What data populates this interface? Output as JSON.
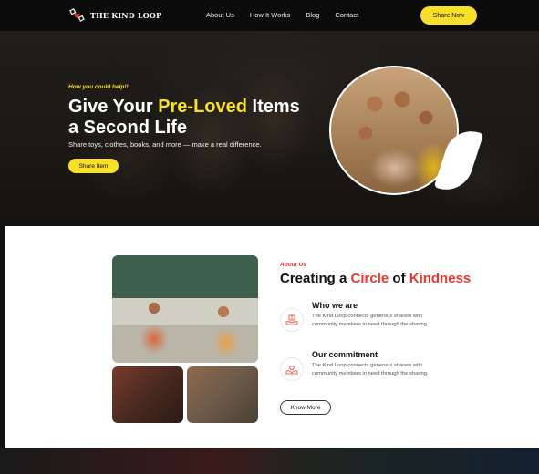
{
  "nav": {
    "brand": "THE KIND LOOP",
    "links": [
      "About Us",
      "How It Works",
      "Blog",
      "Contact"
    ],
    "cta": "Share Now"
  },
  "hero": {
    "eyebrow": "How you could help!!",
    "title_part1": "Give Your ",
    "title_highlight": "Pre-Loved",
    "title_part2": " Items a Second Life",
    "subtitle": "Share toys, clothes, books, and more — make a real difference.",
    "button": "Share Item"
  },
  "about": {
    "eyebrow": "About Us",
    "title_part1": "Creating a ",
    "title_highlight1": "Circle",
    "title_part2": " of ",
    "title_highlight2": "Kindness",
    "features": [
      {
        "title": "Who we are",
        "text": "The Kind Loop connects generous sharers with community members in need through the sharing.",
        "icon": "hands-gift-icon"
      },
      {
        "title": "Our commitment",
        "text": "The Kind Loop connects generous sharers with community members in need through the sharing.",
        "icon": "hands-heart-icon"
      }
    ],
    "button": "Know More"
  },
  "colors": {
    "accent_yellow": "#f7df2a",
    "accent_red": "#e8372e",
    "dark": "#0b0b0b"
  }
}
